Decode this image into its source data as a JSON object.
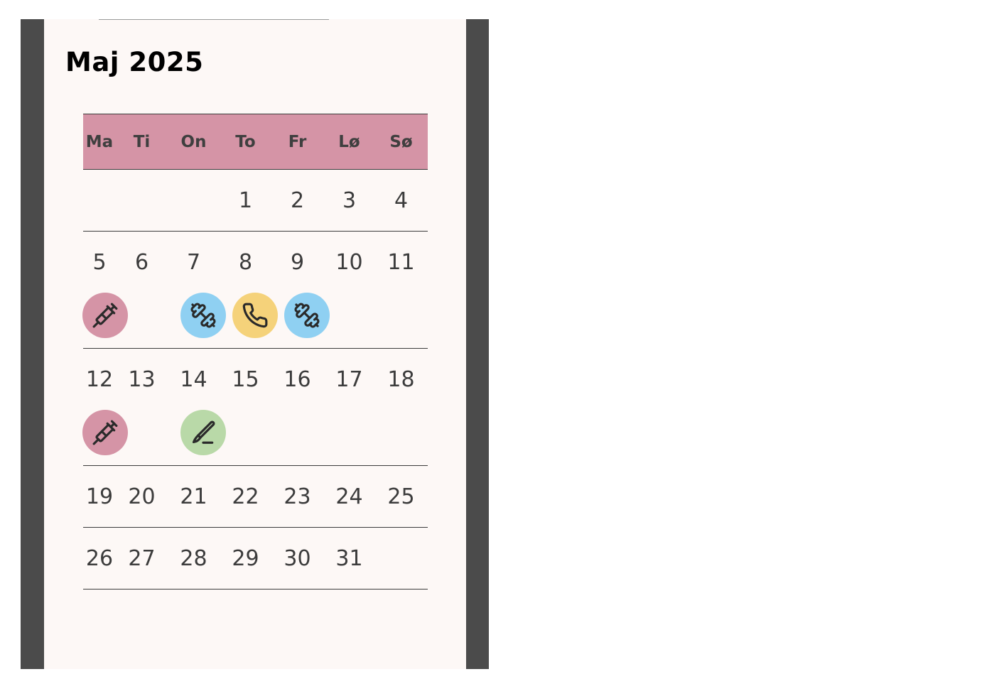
{
  "calendar": {
    "month_title": "Maj 2025",
    "weekdays": [
      "Ma",
      "Ti",
      "On",
      "To",
      "Fr",
      "Lø",
      "Sø"
    ],
    "weeks": [
      {
        "days": [
          "",
          "",
          "",
          "1",
          "2",
          "3",
          "4"
        ],
        "events": []
      },
      {
        "days": [
          "5",
          "6",
          "7",
          "8",
          "9",
          "10",
          "11"
        ],
        "events": [
          {
            "day": "5",
            "icon": "syringe-icon",
            "color": "#d594a6"
          },
          {
            "day": "7",
            "icon": "dumbbell-icon",
            "color": "#8fd0f2"
          },
          {
            "day": "8",
            "icon": "phone-icon",
            "color": "#f5d27a"
          },
          {
            "day": "9",
            "icon": "dumbbell-icon",
            "color": "#8fd0f2"
          }
        ]
      },
      {
        "days": [
          "12",
          "13",
          "14",
          "15",
          "16",
          "17",
          "18"
        ],
        "events": [
          {
            "day": "12",
            "icon": "syringe-icon",
            "color": "#d594a6"
          },
          {
            "day": "14",
            "icon": "scalpel-icon",
            "color": "#b9d9a8"
          }
        ]
      },
      {
        "days": [
          "19",
          "20",
          "21",
          "22",
          "23",
          "24",
          "25"
        ],
        "events": []
      },
      {
        "days": [
          "26",
          "27",
          "28",
          "29",
          "30",
          "31",
          ""
        ],
        "events": []
      }
    ]
  },
  "colors": {
    "header_bg": "#d594a6",
    "page_bg": "#fdf8f6",
    "frame_bg": "#4b4b4b",
    "syringe": "#d594a6",
    "dumbbell": "#8fd0f2",
    "phone": "#f5d27a",
    "scalpel": "#b9d9a8"
  }
}
